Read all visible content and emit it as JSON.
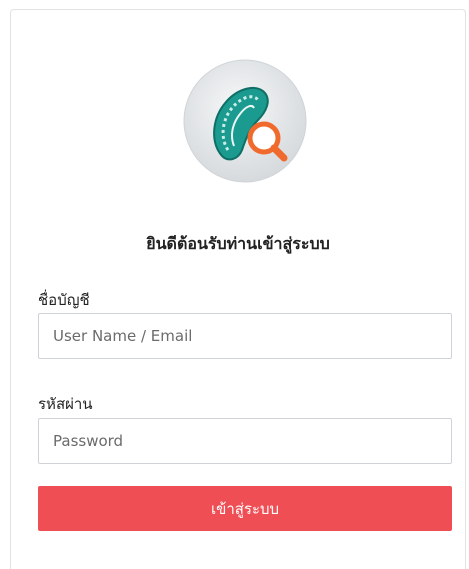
{
  "login": {
    "welcome_title": "ยินดีต้อนรับท่านเข้าสู่ระบบ",
    "username_label": "ชื่อบัญชี",
    "username_placeholder": "User Name / Email",
    "password_label": "รหัสผ่าน",
    "password_placeholder": "Password",
    "submit_label": "เข้าสู่ระบบ"
  },
  "colors": {
    "button": "#f04e55",
    "logo_ring": "#dfe3e6",
    "logo_teal": "#1b9a8f",
    "logo_magnifier": "#f06a2e"
  },
  "icons": {
    "logo": "spine-magnifier-logo"
  }
}
